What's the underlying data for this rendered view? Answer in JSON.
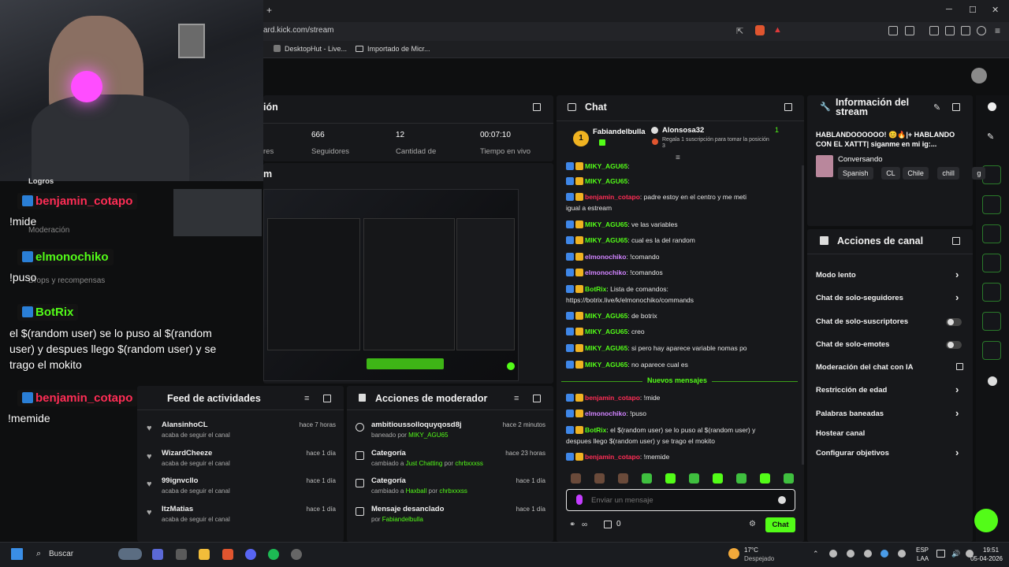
{
  "browser": {
    "url": "ard.kick.com/stream",
    "bookmarks": [
      "DesktopHut - Live...",
      "Importado de Micr..."
    ],
    "new_tab": "+"
  },
  "stats": {
    "title_partial": "ión",
    "tab_partial": "m",
    "values": [
      "666",
      "12",
      "00:07:10"
    ],
    "labels": [
      "res",
      "Seguidores",
      "Cantidad de",
      "Tiempo en vivo"
    ]
  },
  "chat": {
    "title": "Chat",
    "pinned": [
      {
        "user": "Fabiandelbulla",
        "rank": "1"
      },
      {
        "user": "Alonsosa32",
        "rank": "1",
        "note": "Regala 1 suscripción para tomar la posición 3"
      }
    ],
    "lines": [
      {
        "user": "MIKY_AGU65",
        "cls": "ug",
        "msg": ":"
      },
      {
        "user": "MIKY_AGU65",
        "cls": "ug",
        "msg": ":"
      },
      {
        "user": "benjamin_cotapo",
        "cls": "ur",
        "msg": ": padre estoy en el centro y me meti"
      },
      {
        "user": "",
        "cls": "",
        "msg": "igual a estream"
      },
      {
        "user": "MIKY_AGU65",
        "cls": "ug",
        "msg": ": ve las variables"
      },
      {
        "user": "MIKY_AGU65",
        "cls": "ug",
        "msg": ": cual es la del random"
      },
      {
        "user": "elmonochiko",
        "cls": "up",
        "msg": ": !comando"
      },
      {
        "user": "elmonochiko",
        "cls": "up",
        "msg": ": !comandos"
      },
      {
        "user": "BotRix",
        "cls": "ug",
        "msg": ": Lista de comandos:"
      },
      {
        "user": "",
        "cls": "",
        "msg": "https://botrix.live/k/elmonochiko/commands"
      },
      {
        "user": "MIKY_AGU65",
        "cls": "ug",
        "msg": ": de botrix"
      },
      {
        "user": "MIKY_AGU65",
        "cls": "ug",
        "msg": ": creo"
      },
      {
        "user": "MIKY_AGU65",
        "cls": "ug",
        "msg": ": si pero hay aparece variable nomas po"
      },
      {
        "user": "MIKY_AGU65",
        "cls": "ug",
        "msg": ": no aparece cual es"
      }
    ],
    "new_messages": "Nuevos mensajes",
    "new_lines": [
      {
        "user": "benjamin_cotapo",
        "cls": "ur",
        "msg": ": !mide"
      },
      {
        "user": "elmonochiko",
        "cls": "up",
        "msg": ": !puso"
      },
      {
        "user": "BotRix",
        "cls": "ug",
        "msg": ": el $(random user) se lo puso al $(random user) y"
      },
      {
        "user": "",
        "cls": "",
        "msg": "despues llego $(random user) y se trago el mokito"
      },
      {
        "user": "benjamin_cotapo",
        "cls": "ur",
        "msg": ": !memide"
      }
    ],
    "input_placeholder": "Enviar un mensaje",
    "points": "0",
    "send_label": "Chat"
  },
  "info": {
    "title": "Información del stream",
    "stream_title": "HABLANDOOOOOO! 😊🔥|+ HABLANDO CON EL XATTT| siganme en mi ig:...",
    "category": "Conversando",
    "tags": [
      "Spanish",
      "CL",
      "Chile",
      "chill",
      "g"
    ]
  },
  "channel_actions": {
    "title": "Acciones de canal",
    "items": [
      {
        "label": "Modo lento",
        "type": "chev"
      },
      {
        "label": "Chat de solo-seguidores",
        "type": "chev"
      },
      {
        "label": "Chat de solo-suscriptores",
        "type": "toggle"
      },
      {
        "label": "Chat de solo-emotes",
        "type": "toggle"
      },
      {
        "label": "Moderación del chat con IA",
        "type": "ext"
      },
      {
        "label": "Restricción de edad",
        "type": "chev"
      },
      {
        "label": "Palabras baneadas",
        "type": "chev"
      },
      {
        "label": "Hostear canal",
        "type": "none"
      },
      {
        "label": "Configurar objetivos",
        "type": "chev"
      }
    ]
  },
  "feed": {
    "title": "Feed de actividades",
    "items": [
      {
        "name": "AlansinhoCL",
        "sub": "acaba de seguir el canal",
        "time": "hace 7 horas"
      },
      {
        "name": "WizardCheeze",
        "sub": "acaba de seguir el canal",
        "time": "hace 1 día"
      },
      {
        "name": "99ignvcllo",
        "sub": "acaba de seguir el canal",
        "time": "hace 1 día"
      },
      {
        "name": "ItzMatias",
        "sub": "acaba de seguir el canal",
        "time": "hace 1 día"
      }
    ]
  },
  "mod_actions": {
    "title": "Acciones de moderador",
    "items": [
      {
        "name": "ambitioussolloquyqosd8j",
        "sub": "baneado por",
        "who": "MIKY_AGU65",
        "time": "hace 2 minutos"
      },
      {
        "name": "Categoría",
        "sub": "cambiado a",
        "what": "Just Chatting",
        "by": "por",
        "who": "chrbxxxss",
        "time": "hace 23 horas"
      },
      {
        "name": "Categoría",
        "sub": "cambiado a",
        "what": "Haxball",
        "by": "por",
        "who": "chrbxxxss",
        "time": "hace 1 día"
      },
      {
        "name": "Mensaje desanclado",
        "sub": "por",
        "who": "Fabiandelbulla",
        "time": "hace 1 día"
      }
    ]
  },
  "left_menu": [
    "Logros",
    "Moderación",
    "Drops y recompensas"
  ],
  "overlay": {
    "messages": [
      {
        "user": "benjamin_cotapo",
        "color": "#ff2d55",
        "text": "!mide"
      },
      {
        "user": "elmonochiko",
        "color": "#53fc18",
        "text": "!puso"
      },
      {
        "user": "BotRix",
        "color": "#53fc18",
        "text": "el $(random user) se lo puso al $(random user) y despues llego $(random user) y se trago el mokito"
      },
      {
        "user": "benjamin_cotapo",
        "color": "#ff2d55",
        "text": "!memide"
      }
    ]
  },
  "taskbar": {
    "search": "Buscar",
    "weather_temp": "17°C",
    "weather_text": "Despejado",
    "lang": "ESP",
    "lang2": "LAA",
    "time": "19:51",
    "date": "05-04-2026"
  },
  "colors": {
    "accent": "#53fc18",
    "bg": "#0e0f10",
    "panel": "#17181b"
  }
}
